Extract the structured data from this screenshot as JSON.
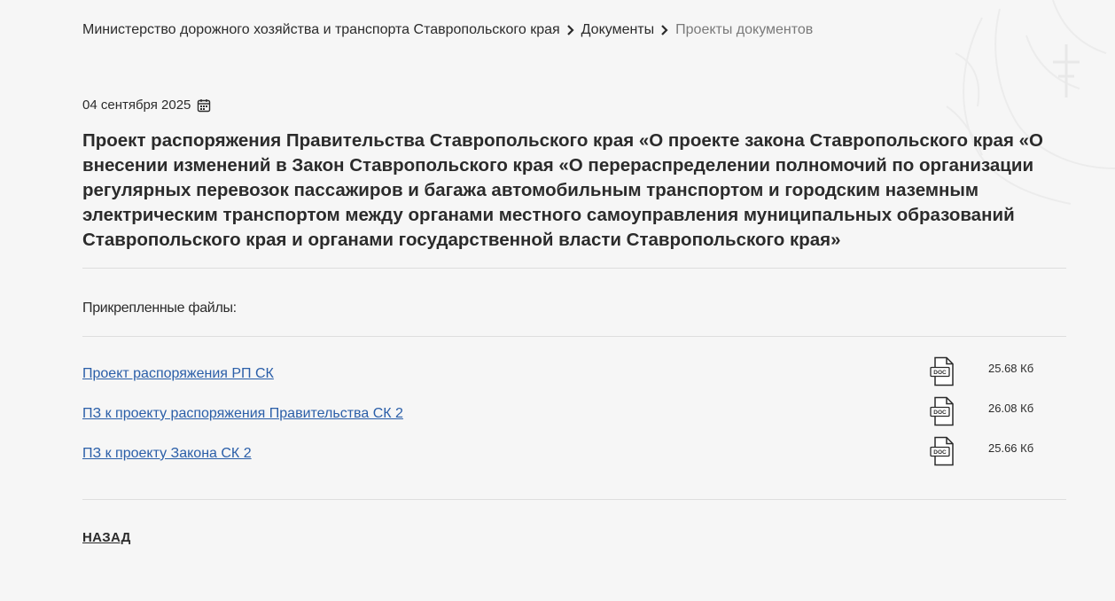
{
  "breadcrumb": {
    "items": [
      {
        "label": "Министерство дорожного хозяйства и транспорта Ставропольского края"
      },
      {
        "label": "Документы"
      },
      {
        "label": "Проекты документов"
      }
    ]
  },
  "document": {
    "date": "04 сентября 2025",
    "title": "Проект распоряжения Правительства Ставропольского края «О проекте закона Ставропольского края «О внесении изменений в Закон Ставропольского края «О перераспределении полномочий по организации регулярных перевозок пассажиров и багажа автомобильным транспортом и городским наземным электрическим транспортом между органами местного самоуправления муниципальных образований Ставропольского края и органами государственной власти Ставропольского края»"
  },
  "attachments": {
    "label": "Прикрепленные файлы:",
    "icon_text": "DOC",
    "files": [
      {
        "name": "Проект распоряжения РП СК",
        "size": "25.68 Кб",
        "icon": "doc-file-icon"
      },
      {
        "name": "ПЗ к проекту распоряжения Правительства СК 2",
        "size": "26.08 Кб",
        "icon": "doc-file-icon"
      },
      {
        "name": "ПЗ к проекту Закона СК 2",
        "size": "25.66 Кб",
        "icon": "doc-file-icon"
      }
    ]
  },
  "navigation": {
    "back_label": "НАЗАД"
  },
  "icons": {
    "separator": "chevron-right-icon",
    "date": "calendar-icon"
  },
  "colors": {
    "background": "#f6f6f6",
    "text": "#2b2b2b",
    "muted": "#7a7a7a",
    "link": "#2a5ea8",
    "divider": "#dedede"
  }
}
